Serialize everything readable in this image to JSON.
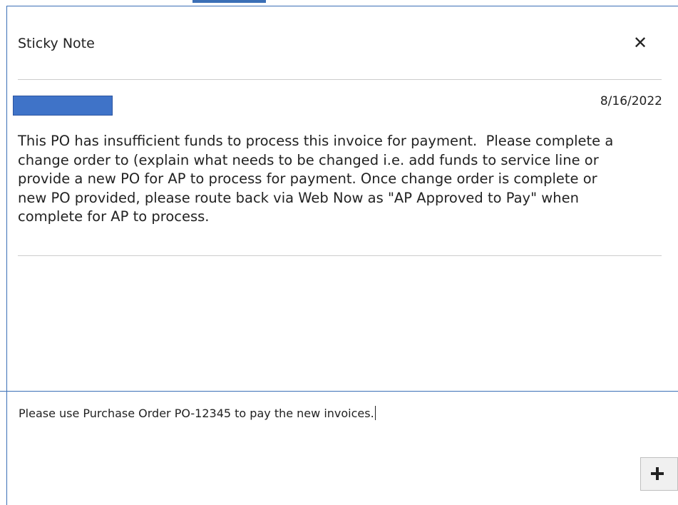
{
  "dialog": {
    "title": "Sticky Note",
    "close_icon": "close-icon",
    "close_symbol": "✕"
  },
  "note": {
    "date": "8/16/2022",
    "author_color": "#3f73c8",
    "body": "This PO has insufficient funds to process this invoice for payment.  Please complete a\nchange order to (explain what needs to be changed i.e. add funds to service line or\nprovide a new PO for AP to process for payment. Once change order is complete or\nnew PO provided, please route back via Web Now as \"AP Approved to Pay\" when\ncomplete for AP to process."
  },
  "compose": {
    "value": "Please use Purchase Order PO-12345 to pay the new invoices.",
    "add_icon": "plus-icon"
  },
  "colors": {
    "accent": "#3b6fb6"
  }
}
